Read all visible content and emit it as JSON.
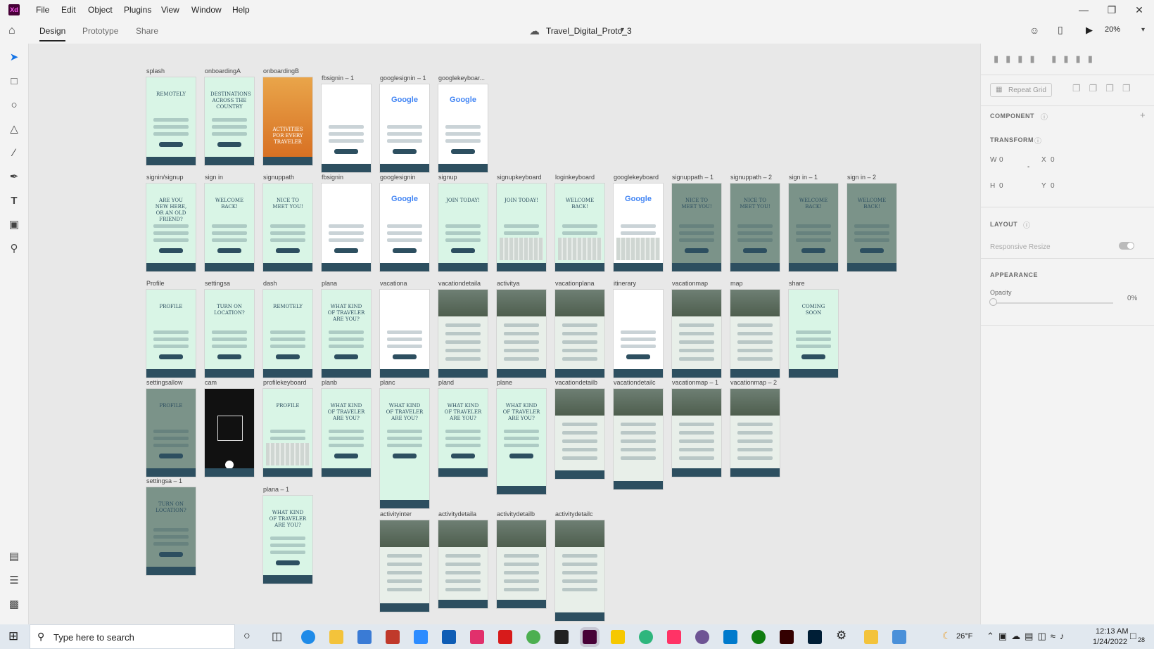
{
  "app": {
    "logo": "Xd",
    "menu": [
      "File",
      "Edit",
      "Object",
      "Plugins",
      "View",
      "Window",
      "Help"
    ]
  },
  "toolbar": {
    "tabs": [
      "Design",
      "Prototype",
      "Share"
    ],
    "document_title": "Travel_Digital_Proto_3",
    "zoom": "20%"
  },
  "tools": [
    "select-icon",
    "rectangle-icon",
    "ellipse-icon",
    "triangle-icon",
    "line-icon",
    "pen-icon",
    "text-icon",
    "artboard-icon",
    "zoom-icon",
    "assets-icon",
    "layers-icon",
    "plugins-icon"
  ],
  "artboards": [
    {
      "label": "splash",
      "style": "mint",
      "text": "REMOTELY"
    },
    {
      "label": "onboardingA",
      "style": "mint",
      "text": "DESTINATIONS ACROSS THE COUNTRY"
    },
    {
      "label": "onboardingB",
      "style": "orange",
      "text": "ACTIVITIES FOR EVERY TRAVELER"
    },
    {
      "label": "fbsignin – 1",
      "style": "white",
      "text": ""
    },
    {
      "label": "googlesignin – 1",
      "style": "white",
      "text": "Google"
    },
    {
      "label": "googlekeyboar...",
      "style": "white",
      "text": "Google"
    },
    {
      "label": "signin/signup",
      "style": "mint",
      "text": "ARE YOU NEW HERE, OR AN OLD FRIEND?"
    },
    {
      "label": "sign in",
      "style": "mint",
      "text": "WELCOME BACK!"
    },
    {
      "label": "signuppath",
      "style": "mint",
      "text": "NICE TO MEET YOU!"
    },
    {
      "label": "fbsignin",
      "style": "white",
      "text": ""
    },
    {
      "label": "googlesignin",
      "style": "white",
      "text": "Google"
    },
    {
      "label": "signup",
      "style": "mint",
      "text": "JOIN TODAY!"
    },
    {
      "label": "signupkeyboard",
      "style": "mint",
      "text": "JOIN TODAY!"
    },
    {
      "label": "loginkeyboard",
      "style": "mint",
      "text": "WELCOME BACK!"
    },
    {
      "label": "googlekeyboard",
      "style": "white",
      "text": "Google"
    },
    {
      "label": "signuppath – 1",
      "style": "gray",
      "text": "NICE TO MEET YOU!"
    },
    {
      "label": "signuppath – 2",
      "style": "gray",
      "text": "NICE TO MEET YOU!"
    },
    {
      "label": "sign in – 1",
      "style": "gray",
      "text": "WELCOME BACK!"
    },
    {
      "label": "sign in – 2",
      "style": "gray",
      "text": "WELCOME BACK!"
    },
    {
      "label": "Profile",
      "style": "mint",
      "text": "PROFILE"
    },
    {
      "label": "settingsa",
      "style": "mint",
      "text": "TURN ON LOCATION?"
    },
    {
      "label": "dash",
      "style": "mint",
      "text": "REMOTELY"
    },
    {
      "label": "plana",
      "style": "mint",
      "text": "WHAT KIND OF TRAVELER ARE YOU?"
    },
    {
      "label": "vacationa",
      "style": "white",
      "text": ""
    },
    {
      "label": "vacationdetaila",
      "style": "photo",
      "text": ""
    },
    {
      "label": "activitya",
      "style": "photo",
      "text": ""
    },
    {
      "label": "vacationplana",
      "style": "photo",
      "text": ""
    },
    {
      "label": "itinerary",
      "style": "white",
      "text": ""
    },
    {
      "label": "vacationmap",
      "style": "photo",
      "text": ""
    },
    {
      "label": "map",
      "style": "photo",
      "text": ""
    },
    {
      "label": "share",
      "style": "mint",
      "text": "COMING SOON"
    },
    {
      "label": "settingsallow",
      "style": "gray",
      "text": "PROFILE"
    },
    {
      "label": "cam",
      "style": "black",
      "text": ""
    },
    {
      "label": "profilekeyboard",
      "style": "mint",
      "text": "PROFILE"
    },
    {
      "label": "planb",
      "style": "mint",
      "text": "WHAT KIND OF TRAVELER ARE YOU?"
    },
    {
      "label": "planc",
      "style": "mint",
      "text": "WHAT KIND OF TRAVELER ARE YOU?"
    },
    {
      "label": "pland",
      "style": "mint",
      "text": "WHAT KIND OF TRAVELER ARE YOU?"
    },
    {
      "label": "plane",
      "style": "mint",
      "text": "WHAT KIND OF TRAVELER ARE YOU?"
    },
    {
      "label": "vacationdetailb",
      "style": "photo",
      "text": ""
    },
    {
      "label": "vacationdetailc",
      "style": "photo",
      "text": ""
    },
    {
      "label": "vacationmap – 1",
      "style": "photo",
      "text": ""
    },
    {
      "label": "vacationmap – 2",
      "style": "photo",
      "text": ""
    },
    {
      "label": "settingsa – 1",
      "style": "gray",
      "text": "TURN ON LOCATION?"
    },
    {
      "label": "plana – 1",
      "style": "mint",
      "text": "WHAT KIND OF TRAVELER ARE YOU?"
    },
    {
      "label": "activityinter",
      "style": "photo",
      "text": ""
    },
    {
      "label": "activitydetaila",
      "style": "photo",
      "text": ""
    },
    {
      "label": "activitydetailb",
      "style": "photo",
      "text": ""
    },
    {
      "label": "activitydetailc",
      "style": "photo",
      "text": ""
    }
  ],
  "rightpanel": {
    "repeat_grid": "Repeat Grid",
    "component": "COMPONENT",
    "transform": "TRANSFORM",
    "w_label": "W",
    "w_value": "0",
    "x_label": "X",
    "x_value": "0",
    "h_label": "H",
    "h_value": "0",
    "y_label": "Y",
    "y_value": "0",
    "layout": "LAYOUT",
    "responsive_resize": "Responsive Resize",
    "appearance": "APPEARANCE",
    "opacity_label": "Opacity",
    "opacity_value": "0%"
  },
  "taskbar": {
    "search_placeholder": "Type here to search",
    "weather": "26°F",
    "time": "12:13 AM",
    "date": "1/24/2022",
    "notifications": "28"
  }
}
